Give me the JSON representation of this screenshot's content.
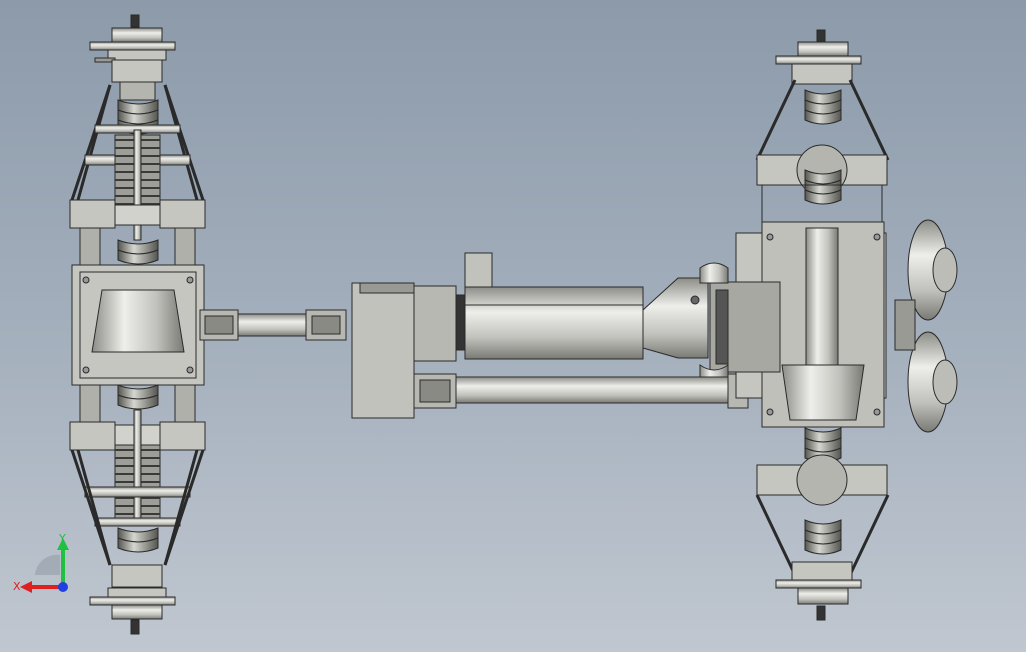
{
  "viewport": {
    "background_top": "#8c9aaa",
    "background_bottom": "#c0c7d0"
  },
  "model": {
    "body_color": "#c6c6c1",
    "dark_color": "#6e6e6a",
    "edge_color": "#2a2a2a"
  },
  "triad": {
    "x_label": "X",
    "y_label": "Y",
    "x_color": "#e02020",
    "y_color": "#20c040",
    "z_color": "#2040e0"
  }
}
